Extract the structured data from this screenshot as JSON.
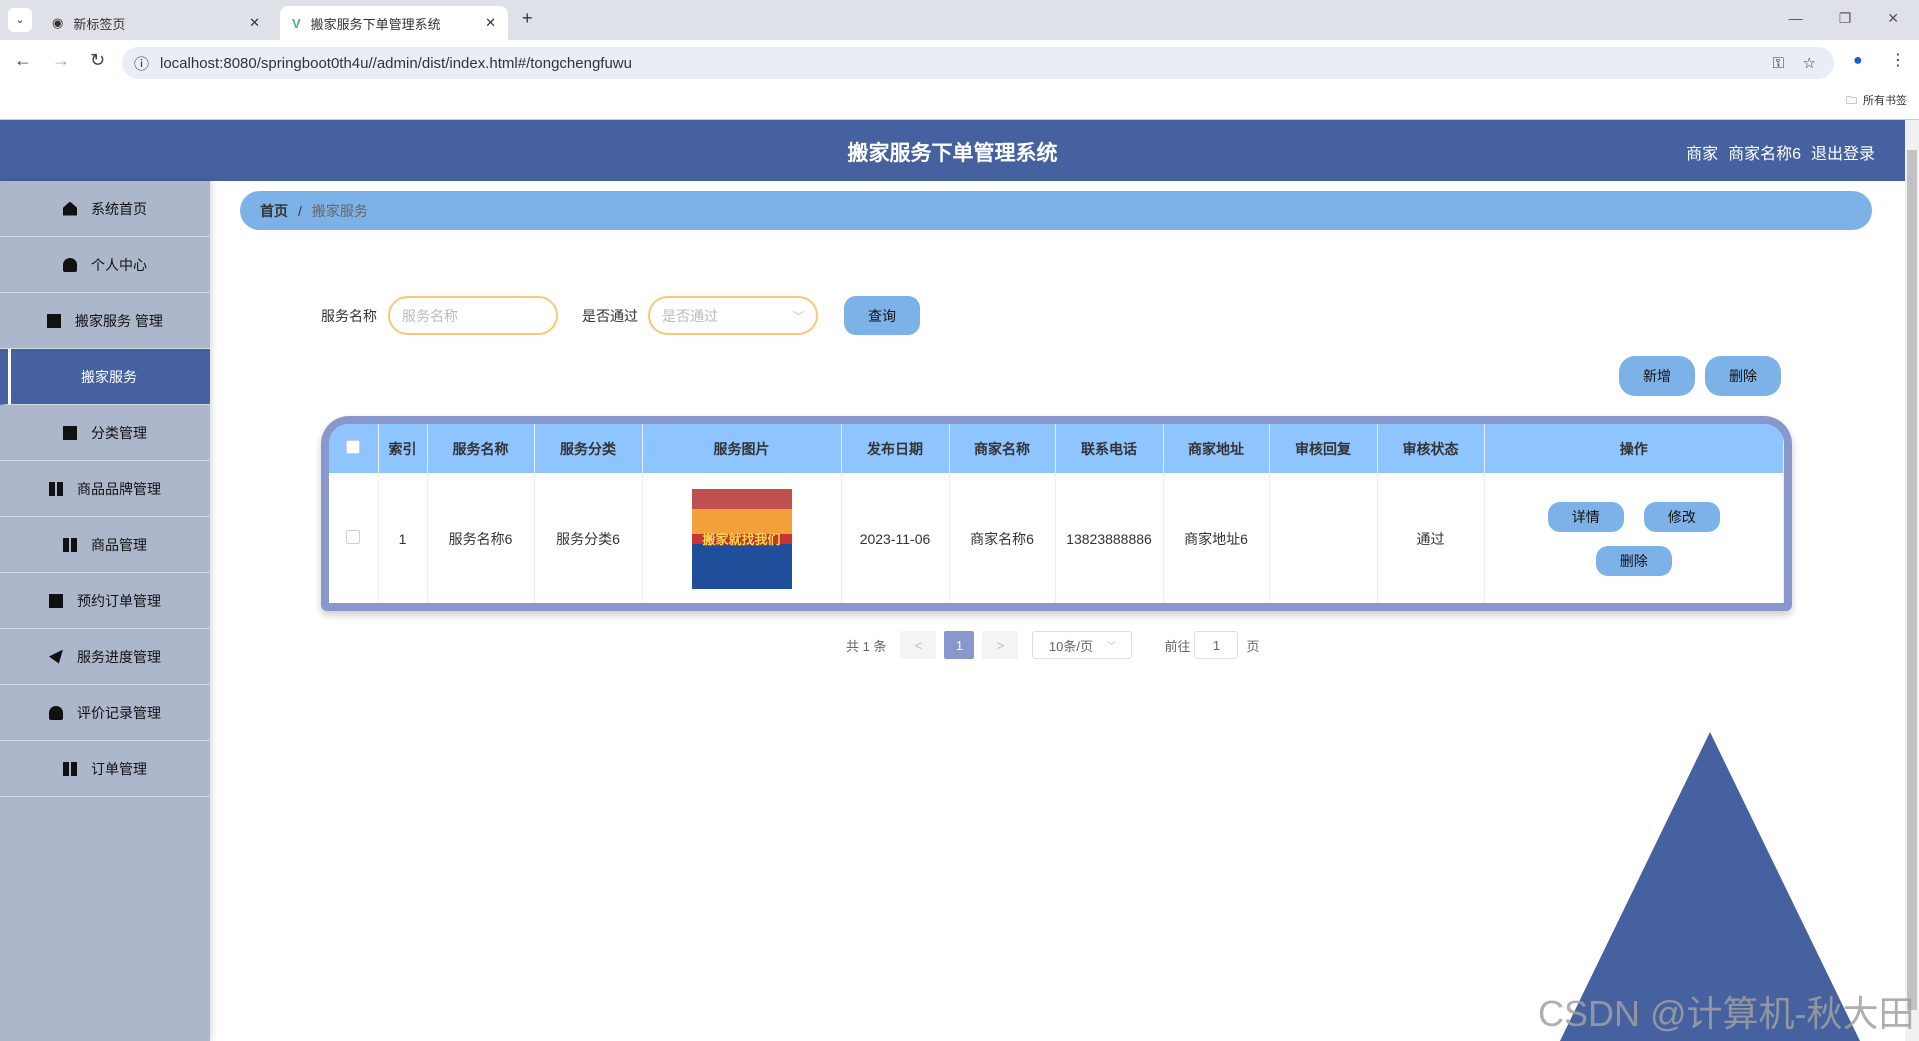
{
  "browser": {
    "tabs": [
      {
        "label": "新标签页"
      },
      {
        "label": "搬家服务下单管理系统"
      }
    ],
    "url": "localhost:8080/springboot0th4u//admin/dist/index.html#/tongchengfuwu",
    "bookmarks": "所有书签"
  },
  "header": {
    "title": "搬家服务下单管理系统",
    "role": "商家",
    "username": "商家名称6",
    "logout": "退出登录"
  },
  "sidebar": {
    "items": [
      {
        "label": "系统首页"
      },
      {
        "label": "个人中心"
      },
      {
        "label": "搬家服务 管理"
      },
      {
        "label": "搬家服务"
      },
      {
        "label": "分类管理"
      },
      {
        "label": "商品品牌管理"
      },
      {
        "label": "商品管理"
      },
      {
        "label": "预约订单管理"
      },
      {
        "label": "服务进度管理"
      },
      {
        "label": "评价记录管理"
      },
      {
        "label": "订单管理"
      }
    ]
  },
  "breadcrumb": {
    "home": "首页",
    "sep": "/",
    "current": "搬家服务"
  },
  "search": {
    "name_label": "服务名称",
    "name_placeholder": "服务名称",
    "pass_label": "是否通过",
    "pass_placeholder": "是否通过",
    "query": "查询"
  },
  "actions": {
    "add": "新增",
    "delete": "删除"
  },
  "table": {
    "headers": [
      "索引",
      "服务名称",
      "服务分类",
      "服务图片",
      "发布日期",
      "商家名称",
      "联系电话",
      "商家地址",
      "审核回复",
      "审核状态",
      "操作"
    ],
    "rows": [
      {
        "index": "1",
        "name": "服务名称6",
        "category": "服务分类6",
        "image_text": "搬家就找我们",
        "date": "2023-11-06",
        "merchant": "商家名称6",
        "phone": "13823888886",
        "address": "商家地址6",
        "reply": "",
        "status": "通过",
        "detail": "详情",
        "edit": "修改",
        "delete": "删除"
      }
    ]
  },
  "pagination": {
    "total": "共 1 条",
    "prev": "<",
    "page": "1",
    "next": ">",
    "size": "10条/页",
    "goto": "前往",
    "goto_value": "1",
    "page_unit": "页"
  },
  "watermark": "CSDN @计算机-秋大田"
}
